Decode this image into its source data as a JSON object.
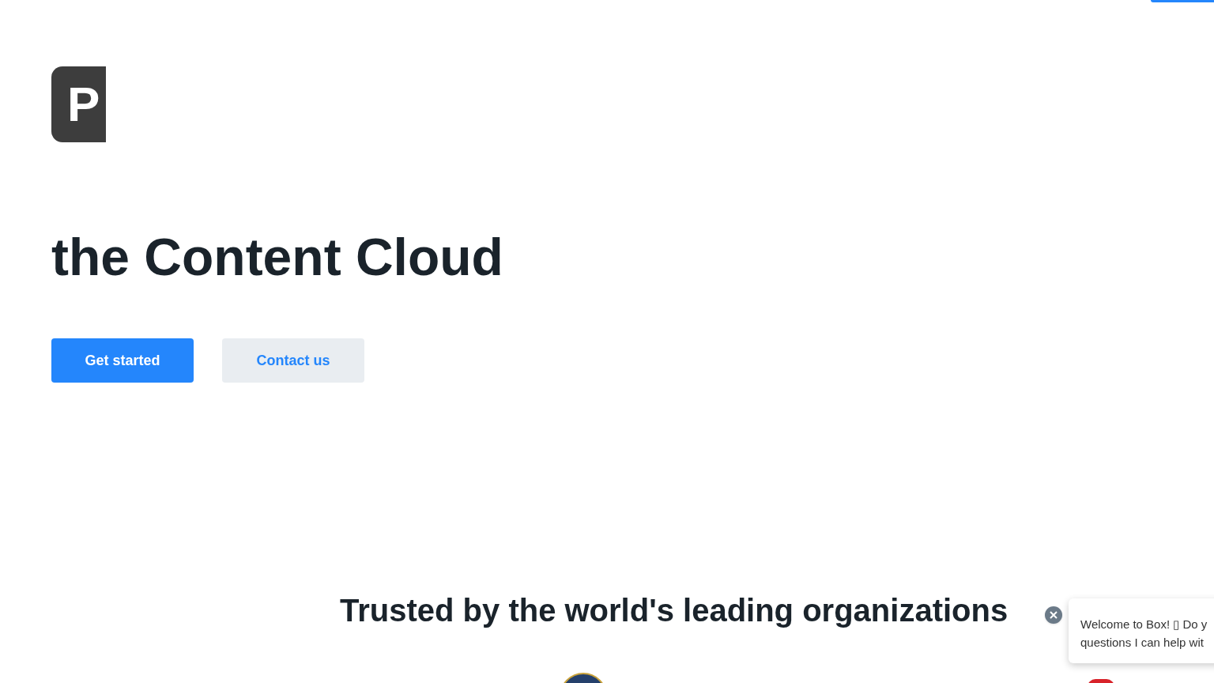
{
  "logo": {
    "letter": "P"
  },
  "hero": {
    "title": "the Content Cloud",
    "buttons": [
      {
        "label": "Get started",
        "kind": "primary"
      },
      {
        "label": "Contact us",
        "kind": "secondary"
      }
    ]
  },
  "trusted": {
    "title": "Trusted by the world's leading organizations"
  },
  "chat": {
    "lines": [
      "Welcome to Box! ▯ Do y",
      "questions I can help wit"
    ]
  }
}
